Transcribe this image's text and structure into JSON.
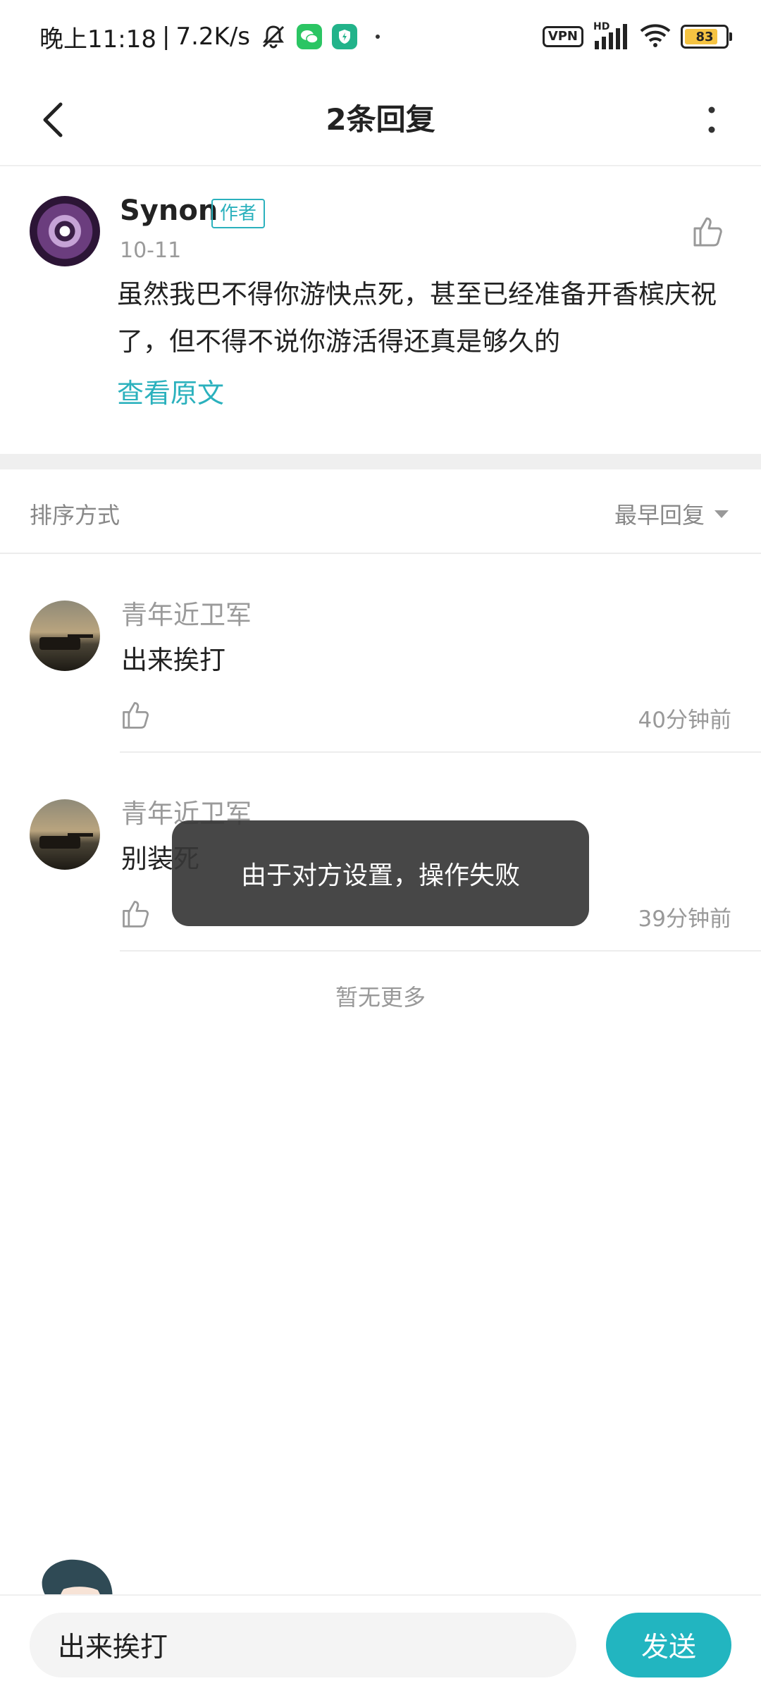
{
  "status_bar": {
    "time": "晚上11:18",
    "separator": "|",
    "network_speed": "7.2K/s",
    "left_icons": [
      "bell-muted-icon",
      "wechat-icon",
      "shield-app-icon",
      "notification-dot-icon"
    ],
    "vpn": "VPN",
    "hd": "HD",
    "battery": "83",
    "battery_level": 0.83,
    "battery_color": "#f5c342"
  },
  "header": {
    "title": "2条回复",
    "back_icon": "chevron-left-icon",
    "more_icon": "more-vertical-icon"
  },
  "original_comment": {
    "author": "Synon",
    "badge": "作者",
    "date": "10-11",
    "text": "虽然我巴不得你游快点死，甚至已经准备开香槟庆祝了，但不得不说你游活得还真是够久的",
    "view_original": "查看原文"
  },
  "sort": {
    "label": "排序方式",
    "value": "最早回复"
  },
  "replies": [
    {
      "author": "青年近卫军",
      "text": "出来挨打",
      "time": "40分钟前"
    },
    {
      "author": "青年近卫军",
      "text": "别装死",
      "time": "39分钟前"
    }
  ],
  "no_more": "暂无更多",
  "toast": "由于对方设置，操作失败",
  "input": {
    "value": "出来挨打",
    "send_label": "发送"
  },
  "colors": {
    "accent": "#2bb1bd",
    "send_button": "#22b5c0",
    "toast_bg": "#373737"
  }
}
